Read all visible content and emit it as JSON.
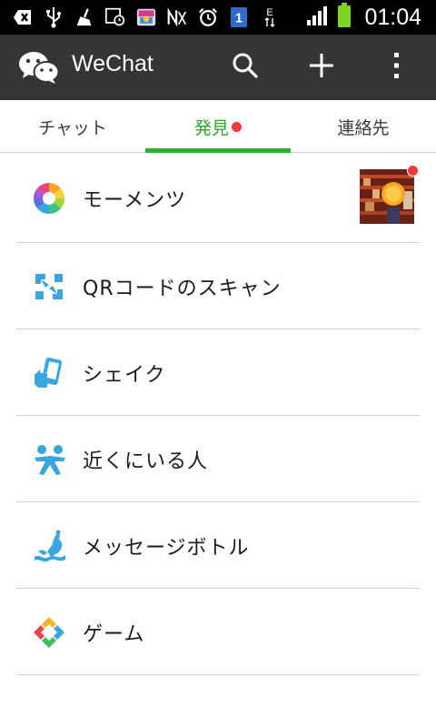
{
  "status_bar": {
    "time": "01:04",
    "icons": [
      "add-box-icon",
      "usb-icon",
      "cleaner-icon",
      "image-clock-icon",
      "bag-app-icon",
      "nfc-icon",
      "alarm-icon",
      "notification-1-icon",
      "data-e-icon",
      "signal-icon",
      "battery-icon"
    ],
    "badge_number": "1",
    "network_label": "E"
  },
  "app_bar": {
    "title": "WeChat",
    "actions": [
      "search-icon",
      "add-icon",
      "more-icon"
    ]
  },
  "tabs": [
    {
      "label": "チャット",
      "active": false
    },
    {
      "label": "発見",
      "active": true,
      "has_badge": true
    },
    {
      "label": "連絡先",
      "active": false
    }
  ],
  "list": [
    {
      "label": "モーメンツ",
      "icon": "moments-icon",
      "has_thumbnail": true,
      "badge": true
    },
    {
      "label": "QRコードのスキャン",
      "icon": "qr-scan-icon"
    },
    {
      "label": "シェイク",
      "icon": "shake-icon"
    },
    {
      "label": "近くにいる人",
      "icon": "people-nearby-icon"
    },
    {
      "label": "メッセージボトル",
      "icon": "drift-bottle-icon"
    },
    {
      "label": "ゲーム",
      "icon": "games-icon"
    }
  ],
  "colors": {
    "accent_green": "#2fb12f",
    "app_bar_bg": "#333536",
    "badge_red": "#f03b3b",
    "icon_blue": "#3aa6e0"
  }
}
